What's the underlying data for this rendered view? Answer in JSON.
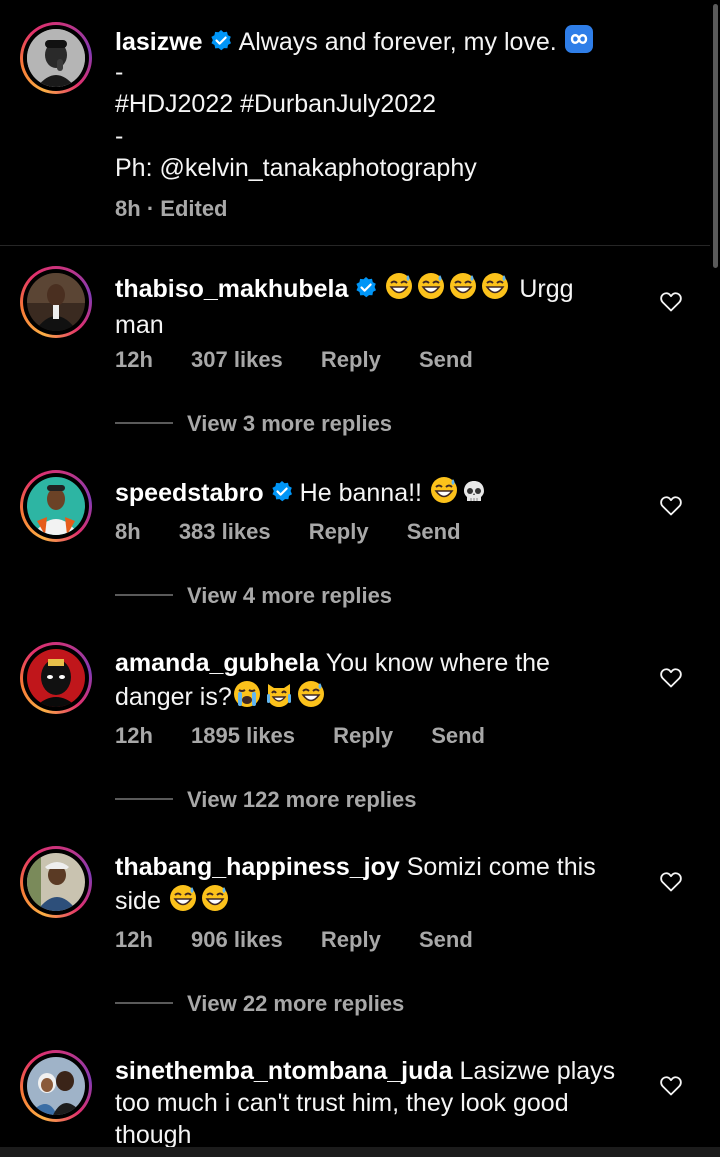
{
  "post": {
    "username": "lasizwe",
    "caption_text": "Always and forever, my love.",
    "caption_icon": "infinity-emoji",
    "line_separator_1": "-",
    "hashtags": "#HDJ2022 #DurbanJuly2022",
    "line_separator_2": "-",
    "photo_credit": "Ph: @kelvin_tanakaphotography",
    "timestamp": "8h",
    "dot": "·",
    "edited_label": "Edited"
  },
  "comments": [
    {
      "username": "thabiso_makhubela",
      "verified": true,
      "emojis": [
        "grinning-sweat-emoji",
        "grinning-sweat-emoji",
        "grinning-sweat-emoji",
        "grinning-sweat-emoji"
      ],
      "text_line1": "Urgg",
      "text_line2": "man",
      "time": "12h",
      "likes": "307 likes",
      "reply_label": "Reply",
      "send_label": "Send",
      "view_replies": "View 3 more replies"
    },
    {
      "username": "speedstabro",
      "verified": true,
      "text": "He banna!!",
      "emojis": [
        "grinning-sweat-emoji",
        "skull-emoji"
      ],
      "time": "8h",
      "likes": "383 likes",
      "reply_label": "Reply",
      "send_label": "Send",
      "view_replies": "View 4 more replies"
    },
    {
      "username": "amanda_gubhela",
      "verified": false,
      "text_line1": "You know where the",
      "text_line2": "danger is?",
      "emojis": [
        "crying-emoji",
        "cat-joy-emoji",
        "grinning-sweat-emoji"
      ],
      "time": "12h",
      "likes": "1895 likes",
      "reply_label": "Reply",
      "send_label": "Send",
      "view_replies": "View 122 more replies"
    },
    {
      "username": "thabang_happiness_joy",
      "verified": false,
      "text_line1": "Somizi come this",
      "text_line2": "side",
      "emojis": [
        "grinning-sweat-emoji",
        "grinning-sweat-emoji"
      ],
      "time": "12h",
      "likes": "906 likes",
      "reply_label": "Reply",
      "send_label": "Send",
      "view_replies": "View 22 more replies"
    },
    {
      "username": "sinethemba_ntombana_juda",
      "verified": false,
      "text_line1": "Lasizwe plays",
      "text_line2": "too much i can't trust him, they look good",
      "text_line3": "though"
    }
  ],
  "colors": {
    "background": "#000000",
    "text": "#f5f5f5",
    "secondary_text": "#a8a8a8",
    "verified_blue": "#0095f6",
    "divider": "#262626"
  }
}
